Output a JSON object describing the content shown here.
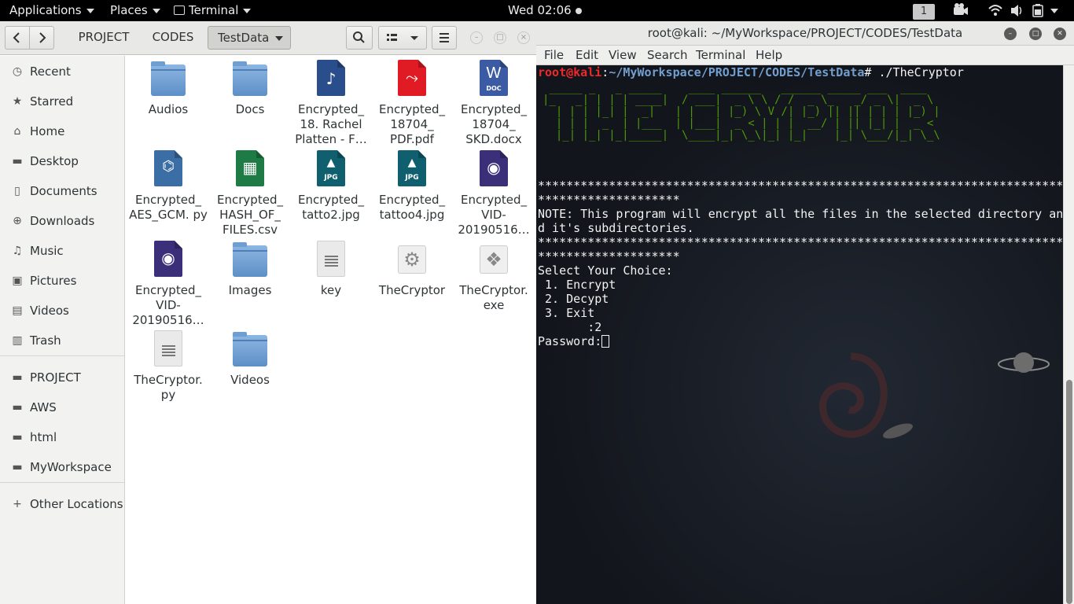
{
  "topbar": {
    "applications": "Applications",
    "places": "Places",
    "terminal": "Terminal",
    "clock": "Wed 02:06",
    "workspace": "1",
    "icons": [
      "video-camera-icon",
      "wifi-icon",
      "volume-icon",
      "battery-icon",
      "power-menu-icon"
    ]
  },
  "files": {
    "breadcrumbs": [
      "PROJECT",
      "CODES",
      "TestData"
    ],
    "sidebar": [
      {
        "label": "Recent",
        "icon": "clock-icon"
      },
      {
        "label": "Starred",
        "icon": "star-icon"
      },
      {
        "label": "Home",
        "icon": "home-icon"
      },
      {
        "label": "Desktop",
        "icon": "folder-icon"
      },
      {
        "label": "Documents",
        "icon": "document-icon"
      },
      {
        "label": "Downloads",
        "icon": "download-icon"
      },
      {
        "label": "Music",
        "icon": "music-icon"
      },
      {
        "label": "Pictures",
        "icon": "pictures-icon"
      },
      {
        "label": "Videos",
        "icon": "film-icon"
      },
      {
        "label": "Trash",
        "icon": "trash-icon"
      },
      {
        "label": "PROJECT",
        "icon": "folder-icon"
      },
      {
        "label": "AWS",
        "icon": "folder-icon"
      },
      {
        "label": "html",
        "icon": "folder-icon"
      },
      {
        "label": "MyWorkspace",
        "icon": "folder-icon"
      },
      {
        "label": "Other Locations",
        "icon": "plus-icon"
      }
    ],
    "items": [
      {
        "name": "Audios",
        "type": "folder"
      },
      {
        "name": "Docs",
        "type": "folder"
      },
      {
        "name": "Encrypted_ 18. Rachel Platten - F…",
        "type": "audio"
      },
      {
        "name": "Encrypted_ 18704_ PDF.pdf",
        "type": "pdf"
      },
      {
        "name": "Encrypted_ 18704_ SKD.docx",
        "type": "docx"
      },
      {
        "name": "Encrypted_ AES_GCM. py",
        "type": "python"
      },
      {
        "name": "Encrypted_ HASH_OF_ FILES.csv",
        "type": "csv"
      },
      {
        "name": "Encrypted_ tatto2.jpg",
        "type": "jpg"
      },
      {
        "name": "Encrypted_ tattoo4.jpg",
        "type": "jpg"
      },
      {
        "name": "Encrypted_ VID- 20190516…",
        "type": "video"
      },
      {
        "name": "Encrypted_ VID- 20190516…",
        "type": "video"
      },
      {
        "name": "Images",
        "type": "folder"
      },
      {
        "name": "key",
        "type": "text"
      },
      {
        "name": "TheCryptor",
        "type": "executable"
      },
      {
        "name": "TheCryptor. exe",
        "type": "exe"
      },
      {
        "name": "TheCryptor. py",
        "type": "text"
      },
      {
        "name": "Videos",
        "type": "folder"
      }
    ]
  },
  "terminal": {
    "title": "root@kali: ~/MyWorkspace/PROJECT/CODES/TestData",
    "menu": [
      "File",
      "Edit",
      "View",
      "Search",
      "Terminal",
      "Help"
    ],
    "prompt_user": "root@kali",
    "prompt_path": "~/MyWorkspace/PROJECT/CODES/TestData",
    "prompt_cmd": "# ./TheCryptor",
    "banner": [
      " _____ _   _ _____    ____ ______   ______ _____ ___  ____",
      "|_   _| | | | ____|  / ___|  _ \\ \\ / /  _ \\_   _/ _ \\|  _ \\",
      "  | | | |_| |  _|   | |   | |_) \\ V /| |_) || || | | | |_) |",
      "  | | |  _  | |___  | |___|  _ < | | |  __/ | || |_| |  _ <",
      "  |_| |_| |_|_____|  \\____|_| \\_\\|_| |_|    |_| \\___/|_| \\_\\"
    ],
    "stars1": "**************************************************************************",
    "stars2": "********************",
    "note1": "NOTE: This program will encrypt all the files in the selected directory an",
    "note2": "d it's subdirectories.",
    "choice_header": "Select Your Choice:",
    "options": [
      " 1. Encrypt",
      " 2. Decypt",
      " 3. Exit"
    ],
    "input_line": "       :2",
    "password_label": "Password:"
  }
}
